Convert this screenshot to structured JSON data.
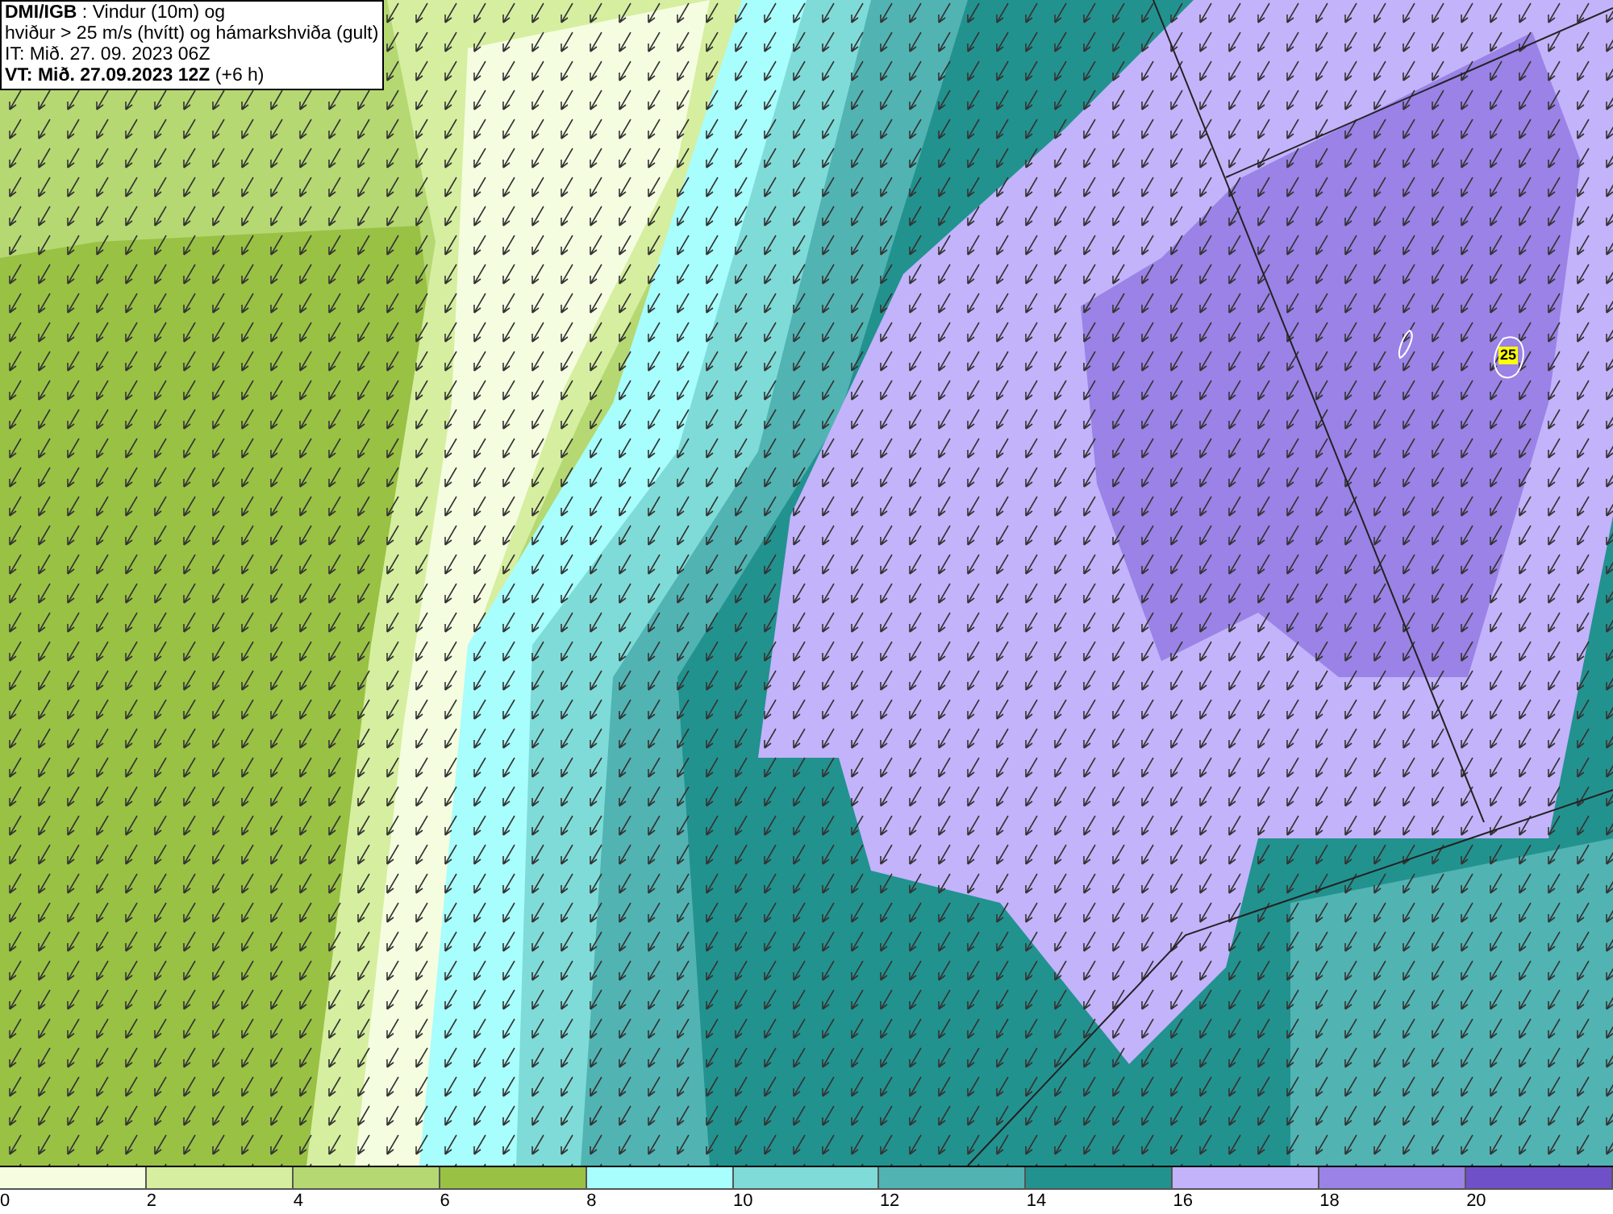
{
  "title_box": {
    "lines": [
      "**DMI/IGB** : Vindur (10m) og",
      "hviður > 25 m/s (hvítt) og hámarkshviða (gult)",
      "IT: Mið. 27. 09. 2023 06Z",
      "**VT: Mið. 27.09.2023 12Z** (+6 h)"
    ]
  },
  "map": {
    "max_gust_label": "25"
  },
  "legend": {
    "bins": [
      {
        "label": "0",
        "color": "#f5fde0"
      },
      {
        "label": "2",
        "color": "#d6ee9f"
      },
      {
        "label": "4",
        "color": "#b5d872"
      },
      {
        "label": "6",
        "color": "#99c144"
      },
      {
        "label": "8",
        "color": "#a8fdfd"
      },
      {
        "label": "10",
        "color": "#7fdbd8"
      },
      {
        "label": "12",
        "color": "#52b3b3"
      },
      {
        "label": "14",
        "color": "#22928f"
      },
      {
        "label": "16",
        "color": "#c2b3fb"
      },
      {
        "label": "18",
        "color": "#9a82e6"
      },
      {
        "label": "20",
        "color": "#6f50c8"
      }
    ]
  }
}
